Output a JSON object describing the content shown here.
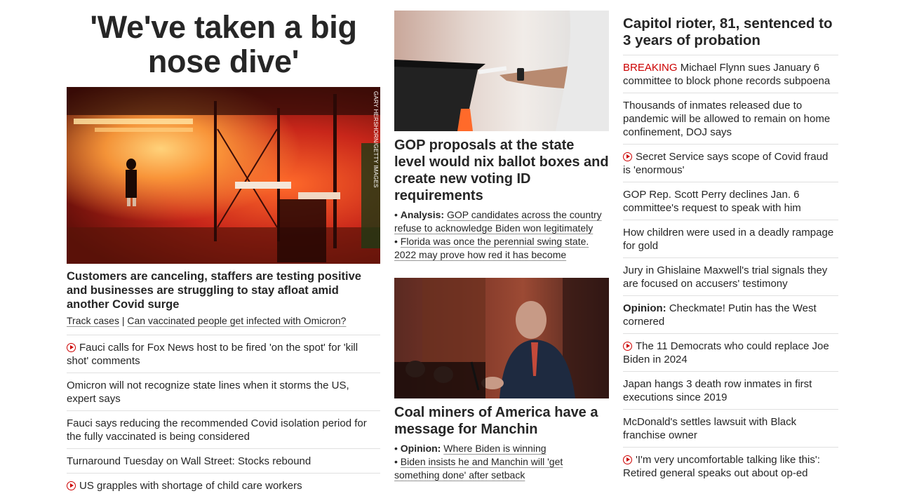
{
  "col1": {
    "headline": "'We've taken a big nose dive'",
    "image_credit": "GARY HERSHORN/GETTY IMAGES",
    "subhead": "Customers are canceling, staffers are testing positive and businesses are struggling to stay afloat amid another Covid surge",
    "link_a": "Track cases",
    "sep": " | ",
    "link_b": "Can vaccinated people get infected with Omicron?",
    "items": [
      {
        "text": "Fauci calls for Fox News host to be fired 'on the spot' for 'kill shot' comments",
        "video": true
      },
      {
        "text": "Omicron will not recognize state lines when it storms the US, expert says",
        "video": false
      },
      {
        "text": "Fauci says reducing the recommended Covid isolation period for the fully vaccinated is being considered",
        "video": false
      },
      {
        "text": "Turnaround Tuesday on Wall Street: Stocks rebound",
        "video": false
      },
      {
        "text": "US grapples with shortage of child care workers",
        "video": true
      }
    ]
  },
  "col2": {
    "story1": {
      "headline": "GOP proposals at the state level would nix ballot boxes and create new voting ID requirements",
      "b1_label": "Analysis:",
      "b1_text": "GOP candidates across the country refuse to acknowledge Biden won legitimately",
      "b2_text": "Florida was once the perennial swing state. 2022 may prove how red it has become"
    },
    "story2": {
      "headline": "Coal miners of America have a message for Manchin",
      "b1_label": "Opinion:",
      "b1_text": "Where Biden is winning",
      "b2_text": "Biden insists he and Manchin will 'get something done' after setback"
    }
  },
  "col3": {
    "headline": "Capitol rioter, 81, sentenced to 3 years of probation",
    "items": [
      {
        "prefix": "BREAKING",
        "prefix_style": "breaking",
        "text": " Michael Flynn sues January 6 committee to block phone records subpoena",
        "video": false
      },
      {
        "prefix": "",
        "prefix_style": "",
        "text": "Thousands of inmates released due to pandemic will be allowed to remain on home confinement, DOJ says",
        "video": false
      },
      {
        "prefix": "",
        "prefix_style": "",
        "text": "Secret Service says scope of Covid fraud is 'enormous'",
        "video": true
      },
      {
        "prefix": "",
        "prefix_style": "",
        "text": "GOP Rep. Scott Perry declines Jan. 6 committee's request to speak with him",
        "video": false
      },
      {
        "prefix": "",
        "prefix_style": "",
        "text": "How children were used in a deadly rampage for gold",
        "video": false
      },
      {
        "prefix": "",
        "prefix_style": "",
        "text": "Jury in Ghislaine Maxwell's trial signals they are focused on accusers' testimony",
        "video": false
      },
      {
        "prefix": "Opinion:",
        "prefix_style": "bold",
        "text": " Checkmate! Putin has the West cornered",
        "video": false
      },
      {
        "prefix": "",
        "prefix_style": "",
        "text": "The 11 Democrats who could replace Joe Biden in 2024",
        "video": true
      },
      {
        "prefix": "",
        "prefix_style": "",
        "text": "Japan hangs 3 death row inmates in first executions since 2019",
        "video": false
      },
      {
        "prefix": "",
        "prefix_style": "",
        "text": "McDonald's settles lawsuit with Black franchise owner",
        "video": false
      },
      {
        "prefix": "",
        "prefix_style": "",
        "text": "'I'm very uncomfortable talking like this': Retired general speaks out about op-ed",
        "video": true
      }
    ]
  },
  "colors": {
    "breaking": "#cc0000",
    "text": "#262626",
    "divider": "#e0e0e0"
  }
}
